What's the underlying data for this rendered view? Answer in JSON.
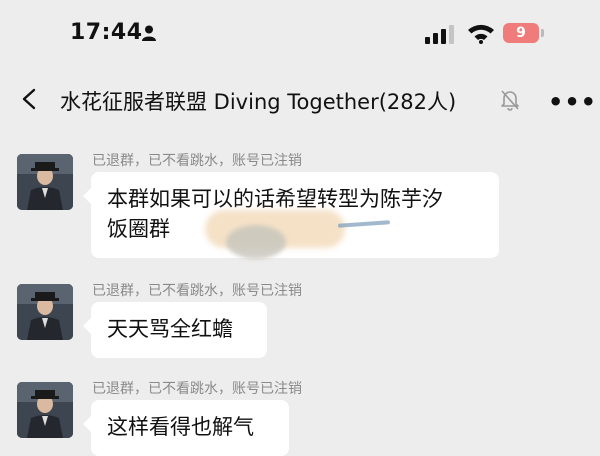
{
  "status_bar": {
    "time": "17:44",
    "battery": "9"
  },
  "header": {
    "title": "水花征服者联盟 Diving Together(282人)"
  },
  "messages": [
    {
      "sender": "已退群，已不看跳水，账号已注销",
      "line1": "本群如果可以的话希望转型为陈芋汐",
      "line2": "饭圈群"
    },
    {
      "sender": "已退群，已不看跳水，账号已注销",
      "text": "天天骂全红蟾"
    },
    {
      "sender": "已退群，已不看跳水，账号已注销",
      "text": "这样看得也解气"
    }
  ],
  "colors": {
    "background": "#ededed",
    "bubble": "#ffffff",
    "battery": "#ef7b7b",
    "sender_text": "#8a8a8a"
  }
}
